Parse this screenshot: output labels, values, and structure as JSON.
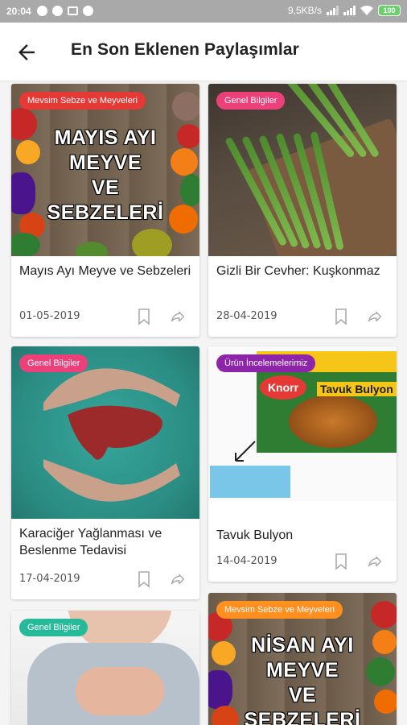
{
  "status_bar": {
    "time": "20:04",
    "network_speed": "9,5KB/s",
    "battery": "100"
  },
  "app_bar": {
    "title": "En Son Eklenen Paylaşımlar",
    "back_icon": "arrow-back-icon"
  },
  "colors": {
    "red_badge": "#e53935",
    "pink_badge": "#ec407a",
    "purple_badge": "#8e24aa",
    "teal_badge": "#26b99a",
    "orange_badge": "#ff8f1f"
  },
  "cards": [
    {
      "category": "Mevsim Sebze ve Meyveleri",
      "image_text": [
        "MAYIS AYI",
        "MEYVE",
        "VE",
        "SEBZELERİ"
      ],
      "title": "Mayıs Ayı Meyve ve Sebzeleri",
      "date": "01-05-2019"
    },
    {
      "category": "Genel Bilgiler",
      "title": "Gizli Bir Cevher: Kuşkonmaz",
      "date": "28-04-2019"
    },
    {
      "category": "Genel Bilgiler",
      "title": "Karaciğer Yağlanması ve Beslenme Tedavisi",
      "date": "17-04-2019"
    },
    {
      "category": "Ürün İncelemelerimiz",
      "image_brand": "Knorr",
      "image_product": "Tavuk Bulyon",
      "title": "Tavuk Bulyon",
      "date": "14-04-2019"
    },
    {
      "category": "Genel Bilgiler"
    },
    {
      "category": "Mevsim Sebze ve Meyveleri",
      "image_text": [
        "NİSAN AYI",
        "MEYVE",
        "VE",
        "SEBZELERİ"
      ]
    }
  ]
}
